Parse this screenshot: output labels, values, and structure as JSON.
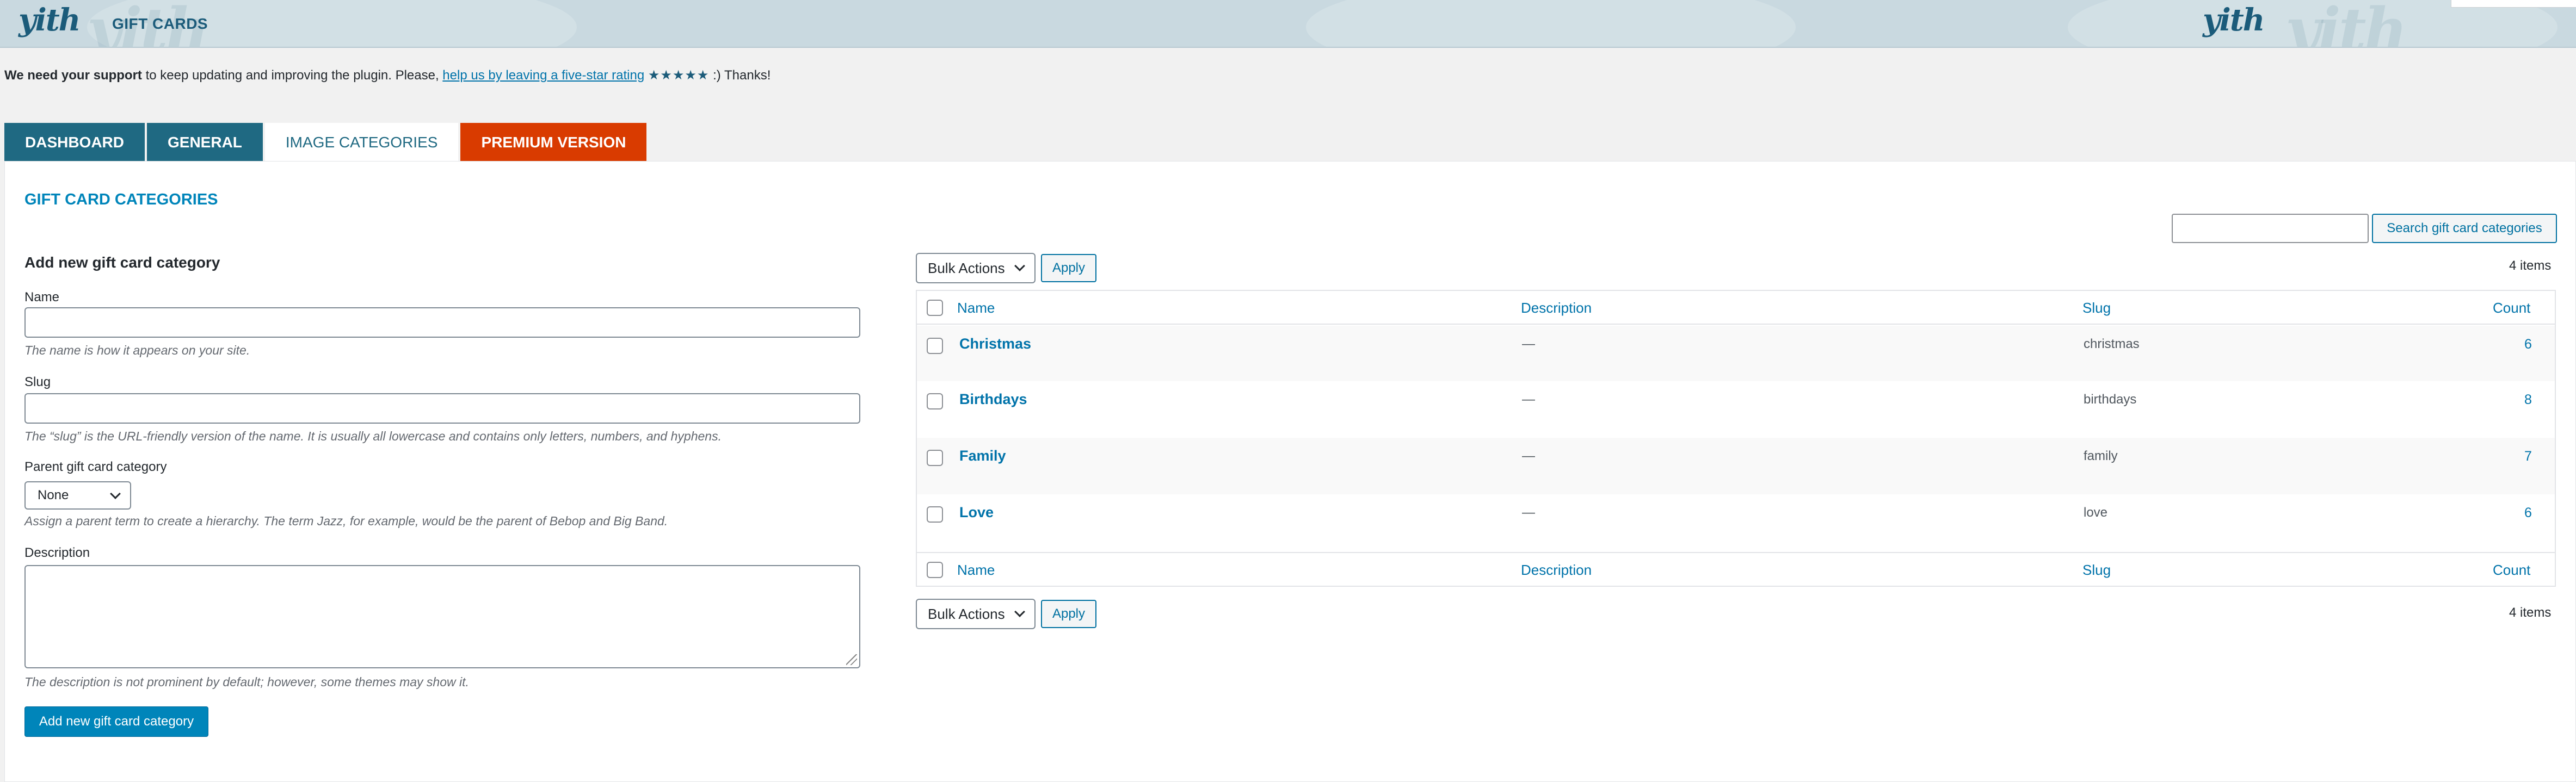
{
  "header": {
    "logo_text": "yith",
    "title": "GIFT CARDS"
  },
  "notice": {
    "strong": "We need your support",
    "text_before": " to keep updating and improving the plugin. Please, ",
    "link": "help us by leaving a five-star rating",
    "stars": "★★★★★",
    "text_after": " :) Thanks!"
  },
  "tabs": [
    {
      "label": "DASHBOARD"
    },
    {
      "label": "GENERAL"
    },
    {
      "label": "IMAGE CATEGORIES"
    },
    {
      "label": "PREMIUM VERSION"
    }
  ],
  "section_title": "GIFT CARD CATEGORIES",
  "form": {
    "title": "Add new gift card category",
    "name_label": "Name",
    "name_hint": "The name is how it appears on your site.",
    "slug_label": "Slug",
    "slug_hint": "The “slug” is the URL-friendly version of the name. It is usually all lowercase and contains only letters, numbers, and hyphens.",
    "parent_label": "Parent gift card category",
    "parent_value": "None",
    "parent_hint": "Assign a parent term to create a hierarchy. The term Jazz, for example, would be the parent of Bebop and Big Band.",
    "description_label": "Description",
    "description_hint": "The description is not prominent by default; however, some themes may show it.",
    "submit_label": "Add new gift card category"
  },
  "list": {
    "search_button": "Search gift card categories",
    "bulk_actions": "Bulk Actions",
    "apply": "Apply",
    "items_count": "4 items",
    "columns": {
      "name": "Name",
      "description": "Description",
      "slug": "Slug",
      "count": "Count"
    },
    "rows": [
      {
        "name": "Christmas",
        "description": "—",
        "slug": "christmas",
        "count": "6"
      },
      {
        "name": "Birthdays",
        "description": "—",
        "slug": "birthdays",
        "count": "8"
      },
      {
        "name": "Family",
        "description": "—",
        "slug": "family",
        "count": "7"
      },
      {
        "name": "Love",
        "description": "—",
        "slug": "love",
        "count": "6"
      }
    ]
  }
}
